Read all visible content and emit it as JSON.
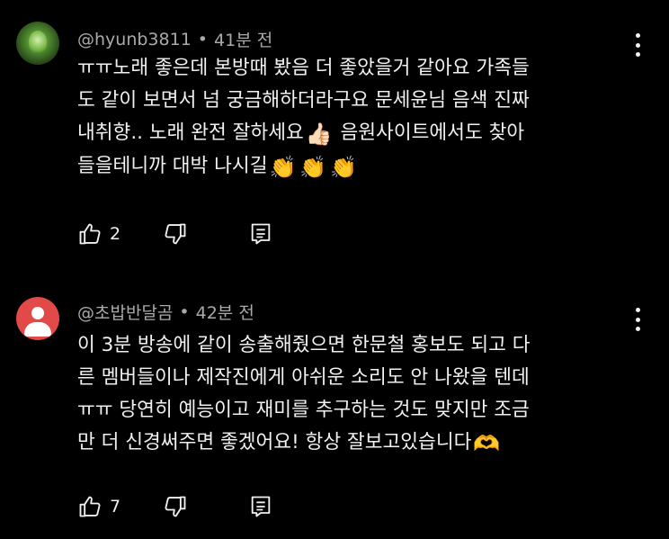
{
  "comments": [
    {
      "author": "@hyunb3811",
      "separator": "•",
      "time": "41분 전",
      "lines": [
        "ㅠㅠ노래 좋은데 본방때 봤음 더 좋았을거 같아요 가족들",
        "도 같이 보면서 넘 궁금해하더라구요 문세윤님 음색 진짜",
        "내취향.. 노래 완전 잘하세요",
        "음원사이트에서도 찾아",
        "들을테니까 대박 나시길"
      ],
      "emojis": {
        "thumbs": "👍🏻",
        "clap1": "👏",
        "clap2": "👏",
        "clap3": "👏"
      },
      "likes": "2",
      "avatar_icon": "green-nature-avatar"
    },
    {
      "author": "@초밥반달곰",
      "separator": "•",
      "time": "42분 전",
      "lines": [
        "이 3분 방송에 같이 송출해줬으면 한문철 홍보도 되고 다",
        "른 멤버들이나 제작진에게 아쉬운 소리도 안 나왔을 텐데",
        "ㅠㅠ 당연히 예능이고 재미를 추구하는 것도 맞지만 조금",
        "만 더 신경써주면 좋겠어요! 항상 잘보고있습니다"
      ],
      "emojis": {
        "heart_hands": "🫶"
      },
      "likes": "7",
      "avatar_icon": "default-user-avatar",
      "avatar_color": "#e24a4a"
    }
  ],
  "colors": {
    "background": "#000000",
    "text": "#f1f1f1",
    "meta": "#aaaaaa"
  },
  "icons": [
    "thumbs-up-icon",
    "thumbs-down-icon",
    "reply-icon",
    "more-vert-icon"
  ]
}
